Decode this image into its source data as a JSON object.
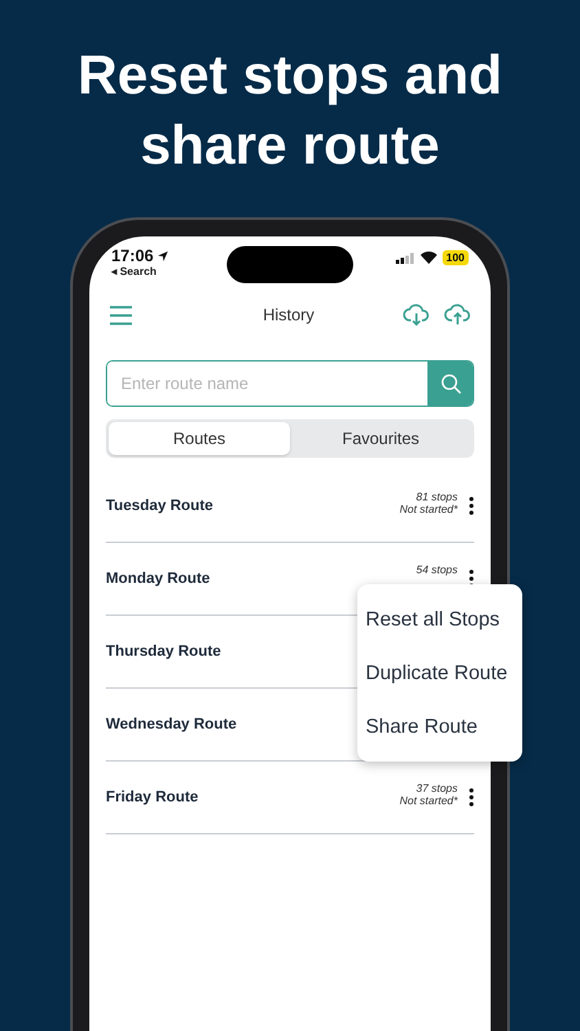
{
  "headline": "Reset stops and share route",
  "status_bar": {
    "time": "17:06",
    "back_label": "◂ Search",
    "battery": "100"
  },
  "header": {
    "title": "History"
  },
  "search": {
    "placeholder": "Enter route name"
  },
  "tabs": [
    {
      "label": "Routes",
      "selected": true
    },
    {
      "label": "Favourites",
      "selected": false
    }
  ],
  "routes": [
    {
      "name": "Tuesday Route",
      "stops": "81 stops",
      "status": "Not started*",
      "more_button": true
    },
    {
      "name": "Monday Route",
      "stops": "54 stops",
      "more_button": true
    },
    {
      "name": "Thursday Route",
      "more_button": false
    },
    {
      "name": "Wednesday Route",
      "more_button": false
    },
    {
      "name": "Friday Route",
      "stops": "37 stops",
      "status": "Not started*",
      "more_button": true
    }
  ],
  "context_menu": {
    "items": [
      "Reset all Stops",
      "Duplicate Route",
      "Share Route"
    ]
  }
}
